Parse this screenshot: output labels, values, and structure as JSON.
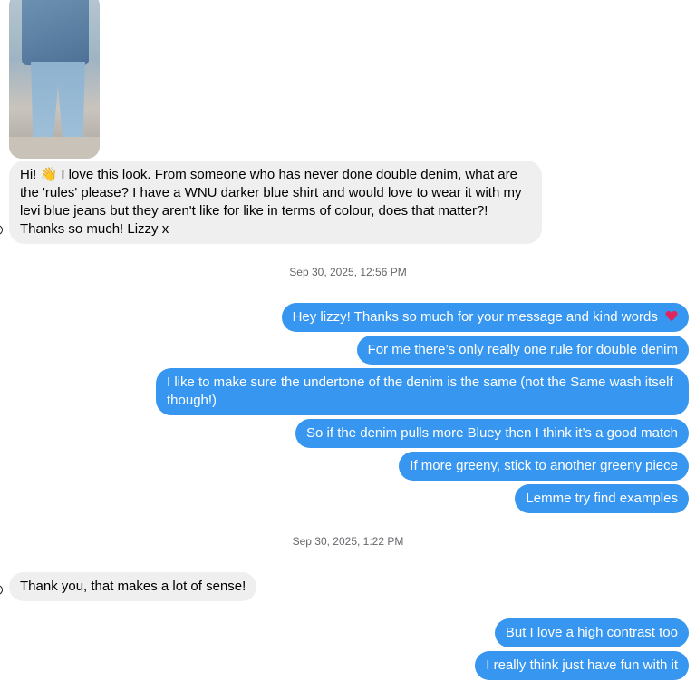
{
  "thread": {
    "messages_block_1": {
      "image_alt": "photo of double denim outfit",
      "incoming_text_1": "Hi! 👋 I love this look. From someone who has never done double denim, what are the 'rules' please? I have a WNU darker blue shirt and would love to wear it with my levi blue jeans but they aren't like for like in terms of colour, does that matter?! Thanks so much! Lizzy x"
    },
    "timestamp_1": "Sep 30, 2025, 12:56 PM",
    "outgoing_block_1": [
      "Hey lizzy! Thanks so much for your message and kind words",
      "For me there’s only really one rule for double denim",
      "I like to make sure the undertone of the denim is the same (not the Same wash itself though!)",
      "So if the denim pulls more Bluey then I think it’s a good match",
      "If more greeny, stick to another greeny piece",
      "Lemme try find examples"
    ],
    "timestamp_2": "Sep 30, 2025, 1:22 PM",
    "incoming_text_2": "Thank you, that makes a lot of sense!",
    "outgoing_block_2": [
      "But I love a high contrast too",
      "I really think just have fun with it"
    ]
  },
  "colors": {
    "outgoing_bubble": "#3797f0",
    "incoming_bubble": "#efefef",
    "timestamp_text": "#65676b",
    "heart": "#e0245e"
  },
  "icons": {
    "heart": "red-heart-icon"
  }
}
